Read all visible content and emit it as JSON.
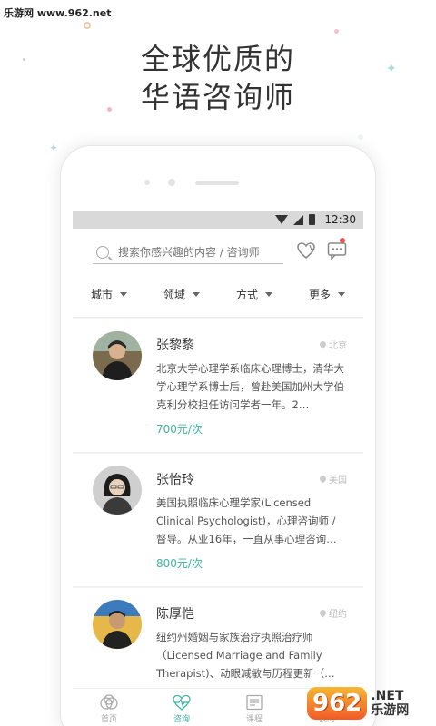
{
  "watermark": {
    "top": "乐游网 www.962.net",
    "logo": "962",
    "suffix_top": ".NET",
    "suffix_bottom": "乐游网"
  },
  "headline": {
    "line1": "全球优质的",
    "line2": "华语咨询师"
  },
  "status_bar": {
    "time": "12:30"
  },
  "search": {
    "placeholder": "搜索你感兴趣的内容 / 咨询师"
  },
  "filters": [
    "城市",
    "领域",
    "方式",
    "更多"
  ],
  "counselors": [
    {
      "name": "张黎黎",
      "location": "北京",
      "description": "北京大学心理学系临床心理博士，清华大学心理学系博士后，曾赴美国加州大学伯克利分校担任访问学者一年。2…",
      "price": "700元/次"
    },
    {
      "name": "张怡玲",
      "location": "美国",
      "description": "美国执照临床心理学家(Licensed Clinical Psychologist)，心理咨询师 / 督导。从业16年，一直从事心理咨询…",
      "price": "800元/次"
    },
    {
      "name": "陈厚恺",
      "location": "纽约",
      "description": "纽约州婚姻与家族治疗执照治疗师（Licensed Marriage and Family Therapist)、动眼减敏与历程更新（…",
      "price": ""
    }
  ],
  "tabs": [
    {
      "label": "首页",
      "icon": "home-icon",
      "active": false
    },
    {
      "label": "咨询",
      "icon": "heartbeat-icon",
      "active": true
    },
    {
      "label": "课程",
      "icon": "book-icon",
      "active": false
    },
    {
      "label": "我的",
      "icon": "user-icon",
      "active": false
    }
  ],
  "colors": {
    "accent": "#3bb5a4",
    "notification": "#f05050"
  }
}
